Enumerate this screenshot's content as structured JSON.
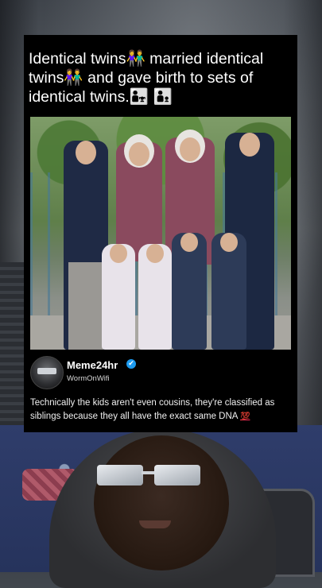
{
  "post": {
    "headline": "Identical twins👫 married identical twins👫 and gave birth to sets of identical twins.👨‍👧 👨‍👦",
    "photo_alt_icon": "family-photo",
    "author": {
      "display_name": "Meme24hr",
      "handle": "WormOnWifi",
      "verified_icon": "verified-badge-icon",
      "verified_glyph": "✔"
    },
    "caption": "Technically the kids aren't even cousins, they're classified as siblings because they all have the exact same DNA",
    "caption_emoji": "💯",
    "colors": {
      "card_background": "#000000",
      "verified_blue": "#1d9bf0"
    }
  }
}
